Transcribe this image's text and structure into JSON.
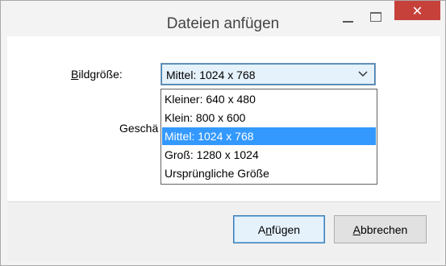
{
  "window": {
    "title": "Dateien anfügen",
    "close_glyph": "✕"
  },
  "form": {
    "image_size_label_key": "B",
    "image_size_label_rest": "ildgröße:",
    "selected_value": "Mittel: 1024 x 768",
    "hidden_label_visible": "Geschä",
    "options": [
      "Kleiner: 640 x 480",
      "Klein: 800 x 600",
      "Mittel: 1024 x 768",
      "Groß: 1280 x 1024",
      "Ursprüngliche Größe"
    ],
    "selected_index": 2
  },
  "buttons": {
    "attach_pre": "A",
    "attach_key": "n",
    "attach_rest": "fügen",
    "cancel_key": "A",
    "cancel_rest": "bbrechen"
  },
  "icons": {
    "minimize": "minimize-icon",
    "maximize": "maximize-icon",
    "close": "close-icon",
    "chevron": "chevron-down-icon"
  },
  "colors": {
    "close_button": "#c7413b",
    "highlight": "#3399ff",
    "focus_border": "#3c7fb1"
  }
}
